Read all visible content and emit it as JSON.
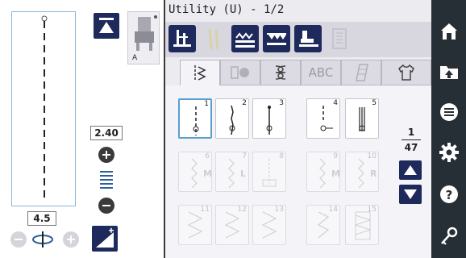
{
  "header": {
    "title": "Utility (U) - 1/2"
  },
  "left_panel": {
    "stitch_length": "2.40",
    "stitch_width": "4.5",
    "presser_foot_label": "A"
  },
  "tabs": [
    {
      "label": "",
      "icon": "utility-stitch-icon",
      "active": true
    },
    {
      "label": "",
      "icon": "character-stitch-icon",
      "active": false
    },
    {
      "label": "",
      "icon": "decorative-stitch-icon",
      "active": false
    },
    {
      "label": "ABC",
      "icon": "",
      "active": false
    },
    {
      "label": "",
      "icon": "quilt-stitch-icon",
      "active": false
    },
    {
      "label": "",
      "icon": "shirt-icon",
      "active": false
    }
  ],
  "stitches": [
    {
      "num": "1",
      "enabled": true,
      "selected": true
    },
    {
      "num": "2",
      "enabled": true,
      "selected": false
    },
    {
      "num": "3",
      "enabled": true,
      "selected": false
    },
    {
      "num": "4",
      "enabled": true,
      "selected": false
    },
    {
      "num": "5",
      "enabled": true,
      "selected": false
    },
    {
      "num": "6",
      "enabled": false,
      "selected": false
    },
    {
      "num": "7",
      "enabled": false,
      "selected": false
    },
    {
      "num": "8",
      "enabled": false,
      "selected": false
    },
    {
      "num": "9",
      "enabled": false,
      "selected": false
    },
    {
      "num": "10",
      "enabled": false,
      "selected": false
    },
    {
      "num": "11",
      "enabled": false,
      "selected": false
    },
    {
      "num": "12",
      "enabled": false,
      "selected": false
    },
    {
      "num": "13",
      "enabled": false,
      "selected": false
    },
    {
      "num": "14",
      "enabled": false,
      "selected": false
    },
    {
      "num": "15",
      "enabled": false,
      "selected": false
    }
  ],
  "page": {
    "current": "1",
    "total": "47"
  },
  "sidebar": [
    {
      "icon": "home-icon"
    },
    {
      "icon": "folder-upload-icon"
    },
    {
      "icon": "menu-icon"
    },
    {
      "icon": "settings-gear-icon"
    },
    {
      "icon": "help-icon"
    },
    {
      "icon": "key-icon"
    }
  ],
  "colors": {
    "accent_dark": "#1f2a5c",
    "sidebar_bg": "#262e36",
    "selected_border": "#5a9fd0"
  }
}
